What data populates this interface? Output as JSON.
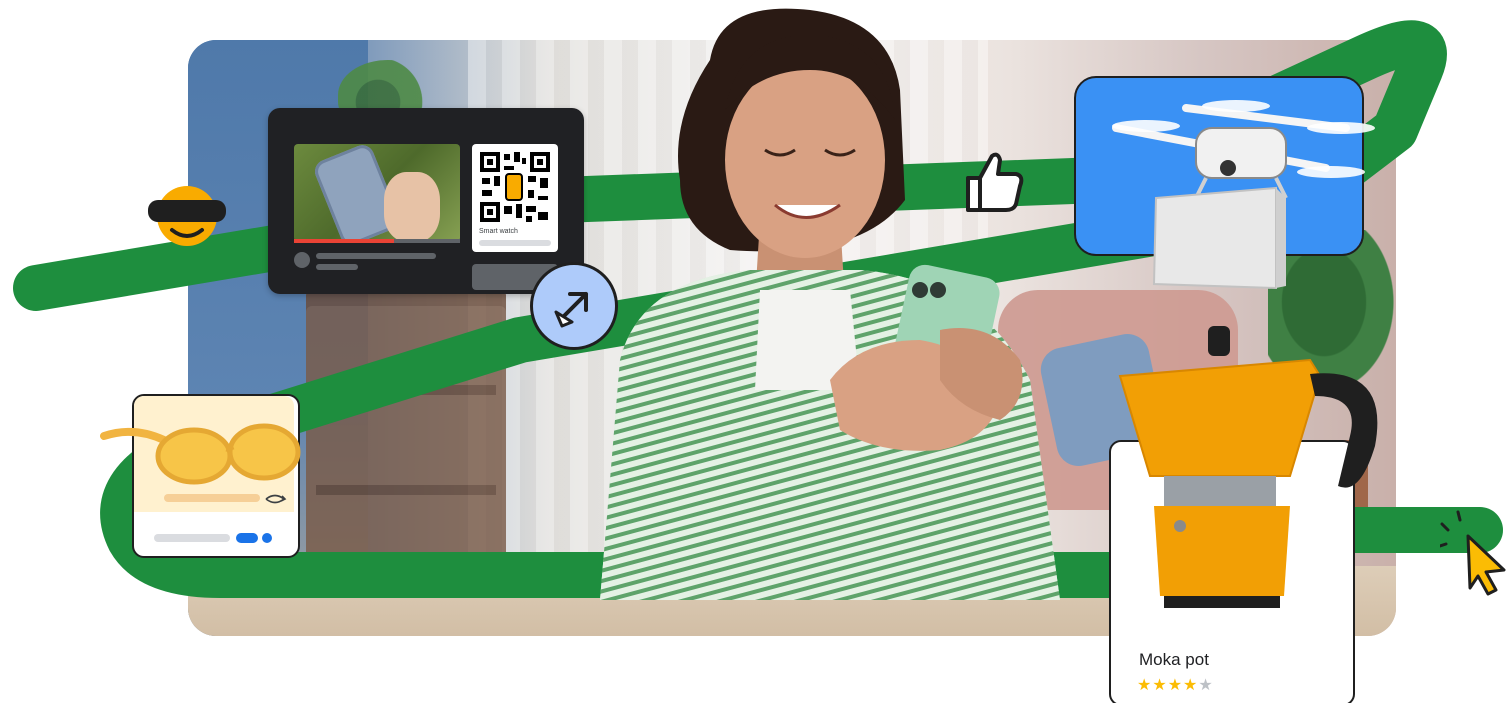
{
  "video_card": {
    "qr_label": "Smart watch",
    "progress": 0.6
  },
  "product_card": {
    "name": "Moka pot",
    "rating": 4,
    "rating_max": 5
  },
  "colors": {
    "ribbon": "#1e8e3e",
    "drone_bg": "#3a91f4",
    "cursor_bubble": "#aecbfa",
    "star": "#fbbc04",
    "moka": "#f29f05",
    "sunglasses": "#f7c548"
  },
  "icons": {
    "vr": "vr-headset-emoji-icon",
    "like": "thumbs-up-icon",
    "cursor_bubble": "cursor-arrow-icon",
    "cursor_right": "pointer-cursor-icon"
  }
}
